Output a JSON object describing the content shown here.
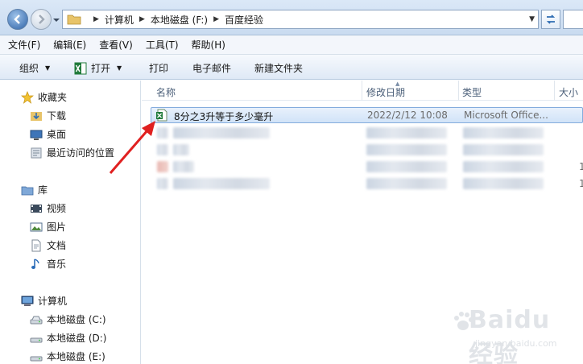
{
  "address_bar": {
    "breadcrumbs": [
      "计算机",
      "本地磁盘 (F:)",
      "百度经验"
    ]
  },
  "menu": [
    "文件(F)",
    "编辑(E)",
    "查看(V)",
    "工具(T)",
    "帮助(H)"
  ],
  "toolbar": {
    "organize": "组织",
    "open": "打开",
    "print": "打印",
    "email": "电子邮件",
    "new_folder": "新建文件夹"
  },
  "nav": {
    "favorites": "收藏夹",
    "downloads": "下载",
    "desktop": "桌面",
    "recent": "最近访问的位置",
    "libraries": "库",
    "videos": "视频",
    "pictures": "图片",
    "documents": "文档",
    "music": "音乐",
    "computer": "计算机",
    "drive_c": "本地磁盘 (C:)",
    "drive_d": "本地磁盘 (D:)",
    "drive_e": "本地磁盘 (E:)"
  },
  "columns": {
    "name": "名称",
    "date": "修改日期",
    "type": "类型",
    "size": "大小"
  },
  "files": [
    {
      "name": "8分之3升等于多少毫升",
      "date": "2022/2/12 10:08",
      "type": "Microsoft Office..."
    }
  ],
  "partial_size_digits": [
    "1",
    "1"
  ],
  "watermark": {
    "text": "Baidu经验",
    "url": "jingyan.baidu.com"
  },
  "colors": {
    "selection_border": "#84acdd",
    "annotation_arrow": "#e02020",
    "excel_green": "#1f7a3a"
  }
}
